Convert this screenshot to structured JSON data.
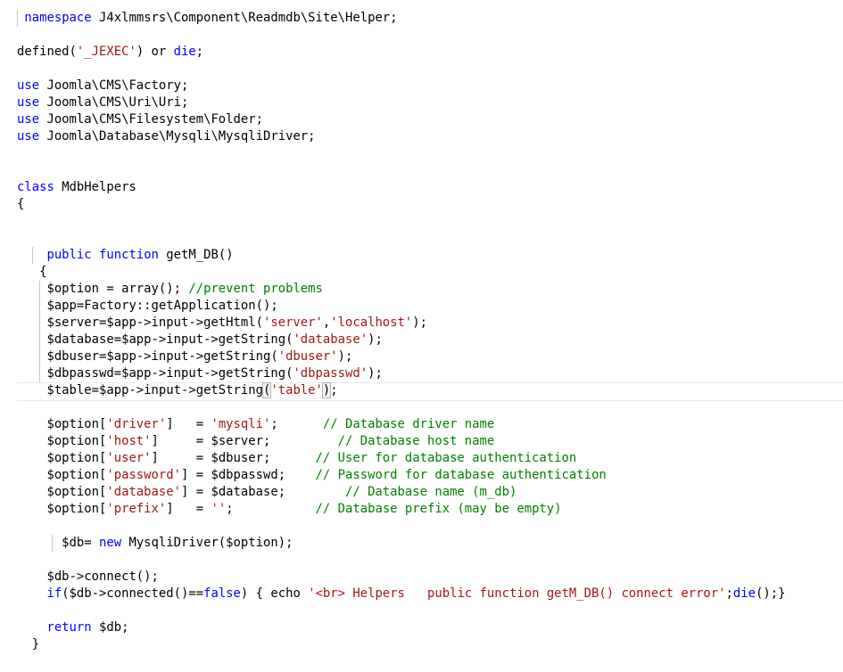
{
  "editor": {
    "lines": [
      [
        {
          "t": " "
        },
        {
          "t": "namespace",
          "c": "kw"
        },
        {
          "t": " J4xlmmsrs\\Component\\Readmdb\\Site\\Helper;"
        }
      ],
      [],
      [
        {
          "t": "defined("
        },
        {
          "t": "'_JEXEC'",
          "c": "str"
        },
        {
          "t": ") or "
        },
        {
          "t": "die",
          "c": "kw"
        },
        {
          "t": ";"
        }
      ],
      [],
      [
        {
          "t": "use",
          "c": "kw"
        },
        {
          "t": " Joomla\\CMS\\Factory;"
        }
      ],
      [
        {
          "t": "use",
          "c": "kw"
        },
        {
          "t": " Joomla\\CMS\\Uri\\Uri;"
        }
      ],
      [
        {
          "t": "use",
          "c": "kw"
        },
        {
          "t": " Joomla\\CMS\\Filesystem\\Folder;"
        }
      ],
      [
        {
          "t": "use",
          "c": "kw"
        },
        {
          "t": " Joomla\\Database\\Mysqli\\MysqliDriver;"
        }
      ],
      [],
      [],
      [
        {
          "t": "class",
          "c": "kw"
        },
        {
          "t": " MdbHelpers"
        }
      ],
      [
        {
          "t": "{"
        }
      ],
      [],
      [],
      [
        {
          "t": "    "
        },
        {
          "t": "public",
          "c": "kw"
        },
        {
          "t": " "
        },
        {
          "t": "function",
          "c": "kw"
        },
        {
          "t": " getM_DB()"
        }
      ],
      [
        {
          "t": "   {"
        }
      ],
      [
        {
          "t": "    $option = array(); "
        },
        {
          "t": "//prevent problems",
          "c": "cmt"
        }
      ],
      [
        {
          "t": "    $app=Factory::getApplication();"
        }
      ],
      [
        {
          "t": "    $server=$app->input->getHtml("
        },
        {
          "t": "'server'",
          "c": "str"
        },
        {
          "t": ","
        },
        {
          "t": "'localhost'",
          "c": "str"
        },
        {
          "t": ");"
        }
      ],
      [
        {
          "t": "    $database=$app->input->getString("
        },
        {
          "t": "'database'",
          "c": "str"
        },
        {
          "t": ");"
        }
      ],
      [
        {
          "t": "    $dbuser=$app->input->getString("
        },
        {
          "t": "'dbuser'",
          "c": "str"
        },
        {
          "t": ");"
        }
      ],
      [
        {
          "t": "    $dbpasswd=$app->input->getString("
        },
        {
          "t": "'dbpasswd'",
          "c": "str"
        },
        {
          "t": ");"
        }
      ],
      [
        {
          "t": "    $table=$app->input->getString"
        },
        {
          "t": "(",
          "c": "bm"
        },
        {
          "t": "'table'",
          "c": "str"
        },
        {
          "t": ")",
          "c": "bm"
        },
        {
          "t": ";"
        }
      ],
      [],
      [
        {
          "t": "    $option["
        },
        {
          "t": "'driver'",
          "c": "str"
        },
        {
          "t": "]   = "
        },
        {
          "t": "'mysqli'",
          "c": "str"
        },
        {
          "t": ";      "
        },
        {
          "t": "// Database driver name",
          "c": "cmt"
        }
      ],
      [
        {
          "t": "    $option["
        },
        {
          "t": "'host'",
          "c": "str"
        },
        {
          "t": "]     = $server;         "
        },
        {
          "t": "// Database host name",
          "c": "cmt"
        }
      ],
      [
        {
          "t": "    $option["
        },
        {
          "t": "'user'",
          "c": "str"
        },
        {
          "t": "]     = $dbuser;      "
        },
        {
          "t": "// User for database authentication",
          "c": "cmt"
        }
      ],
      [
        {
          "t": "    $option["
        },
        {
          "t": "'password'",
          "c": "str"
        },
        {
          "t": "] = $dbpasswd;    "
        },
        {
          "t": "// Password for database authentication",
          "c": "cmt"
        }
      ],
      [
        {
          "t": "    $option["
        },
        {
          "t": "'database'",
          "c": "str"
        },
        {
          "t": "] = $database;        "
        },
        {
          "t": "// Database name (m_db)",
          "c": "cmt"
        }
      ],
      [
        {
          "t": "    $option["
        },
        {
          "t": "'prefix'",
          "c": "str"
        },
        {
          "t": "]   = "
        },
        {
          "t": "''",
          "c": "str"
        },
        {
          "t": ";           "
        },
        {
          "t": "// Database prefix (may be empty)",
          "c": "cmt"
        }
      ],
      [],
      [
        {
          "t": "      $db= "
        },
        {
          "t": "new",
          "c": "kw"
        },
        {
          "t": " MysqliDriver($option);"
        }
      ],
      [],
      [
        {
          "t": "    $db->connect();"
        }
      ],
      [
        {
          "t": "    "
        },
        {
          "t": "if",
          "c": "kw"
        },
        {
          "t": "($db->connected()=="
        },
        {
          "t": "false",
          "c": "kw"
        },
        {
          "t": ") { echo "
        },
        {
          "t": "'<br> Helpers   public function getM_DB() connect error'",
          "c": "str"
        },
        {
          "t": ";"
        },
        {
          "t": "die",
          "c": "kw"
        },
        {
          "t": "();}"
        }
      ],
      [],
      [
        {
          "t": "    "
        },
        {
          "t": "return",
          "c": "kw"
        },
        {
          "t": " $db;"
        }
      ],
      [
        {
          "t": "  }"
        }
      ]
    ]
  }
}
